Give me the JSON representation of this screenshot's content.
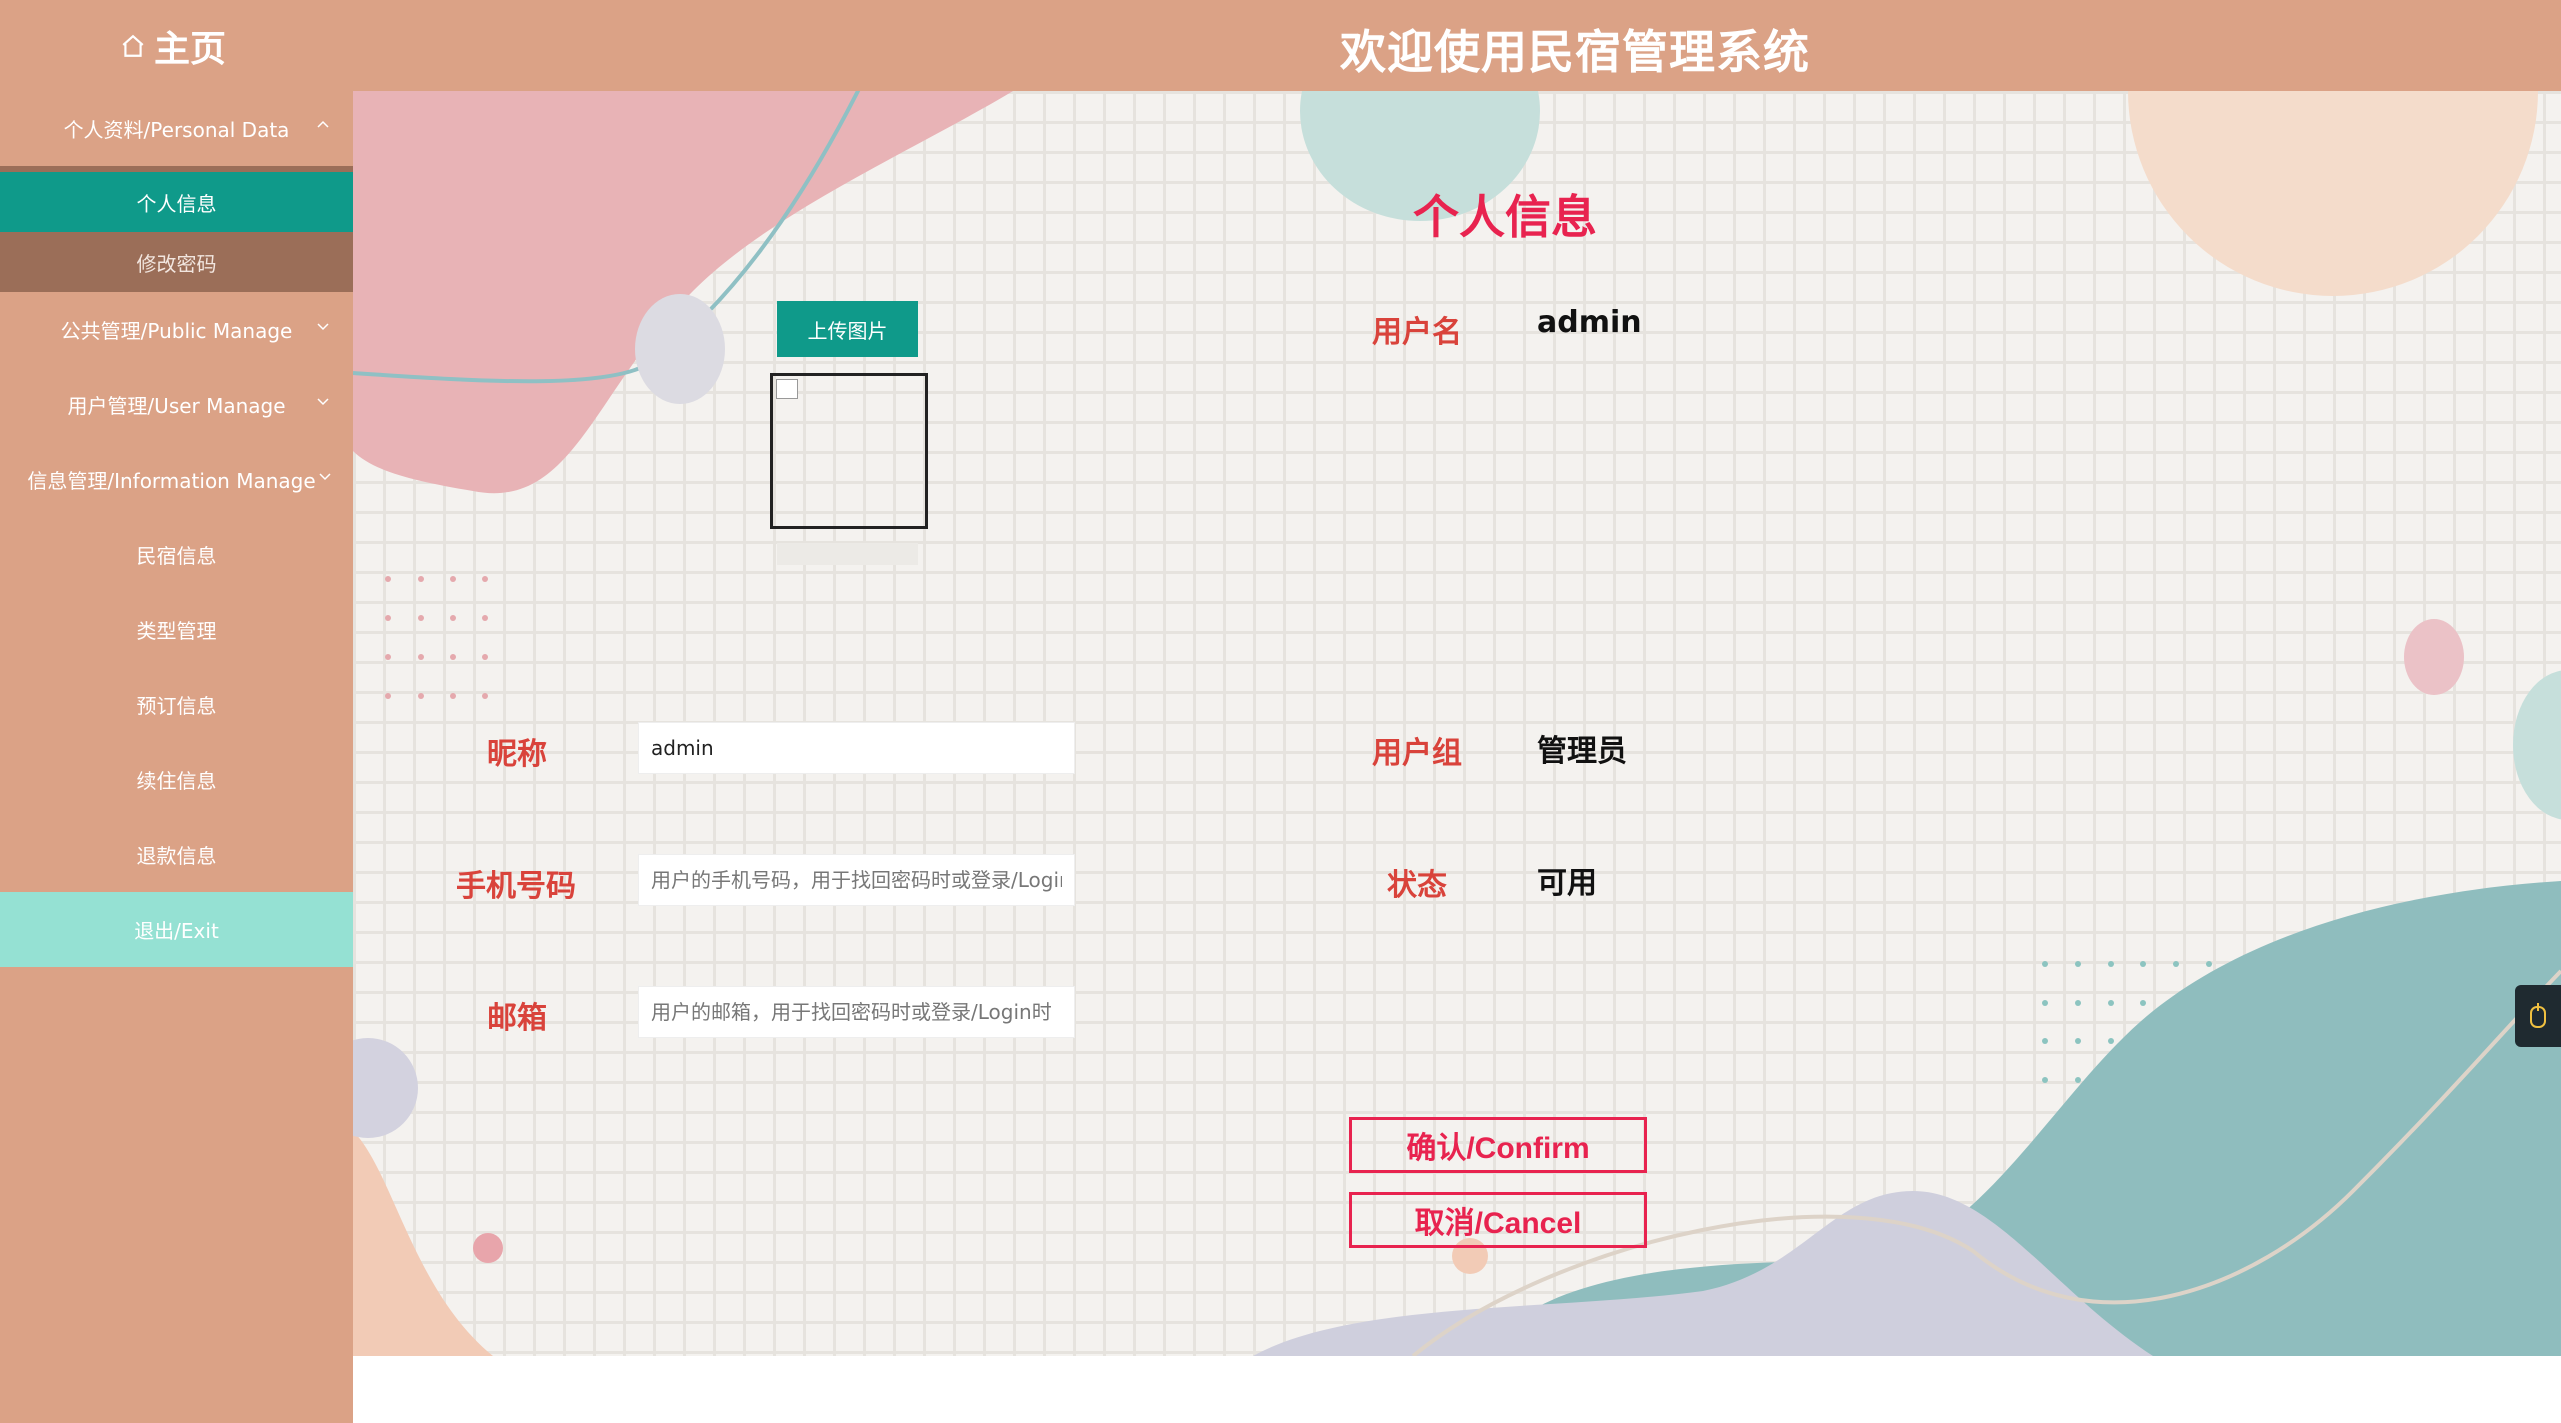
{
  "header": {
    "home_label": "主页",
    "title": "欢迎使用民宿管理系统"
  },
  "sidebar": {
    "groups": [
      {
        "label": "个人资料/Personal Data",
        "expanded": true,
        "items": [
          {
            "label": "个人信息",
            "active": true
          },
          {
            "label": "修改密码",
            "active": false
          }
        ]
      },
      {
        "label": "公共管理/Public Manage",
        "expanded": false
      },
      {
        "label": "用户管理/User Manage",
        "expanded": false
      },
      {
        "label": "信息管理/Information Manage",
        "expanded": false
      }
    ],
    "items": [
      "民宿信息",
      "类型管理",
      "预订信息",
      "续住信息",
      "退款信息"
    ],
    "exit_label": "退出/Exit"
  },
  "main": {
    "heading": "个人信息",
    "upload_label": "上传图片",
    "form": {
      "nickname": {
        "label": "昵称",
        "value": "admin"
      },
      "phone": {
        "label": "手机号码",
        "value": "",
        "placeholder": "用户的手机号码，用于找回密码时或登录/Login时"
      },
      "email": {
        "label": "邮箱",
        "value": "",
        "placeholder": "用户的邮箱，用于找回密码时或登录/Login时"
      }
    },
    "info": {
      "username": {
        "label": "用户名",
        "value": "admin"
      },
      "group": {
        "label": "用户组",
        "value": "管理员"
      },
      "status": {
        "label": "状态",
        "value": "可用"
      }
    },
    "confirm_label": "确认/Confirm",
    "cancel_label": "取消/Cancel"
  },
  "colors": {
    "header_bg": "#dba286",
    "active_item": "#0f9a8a",
    "submenu_bg": "#9b6e58",
    "exit_bg": "#95e1d3",
    "accent_red": "#e8234f",
    "label_red": "#d9433b"
  }
}
